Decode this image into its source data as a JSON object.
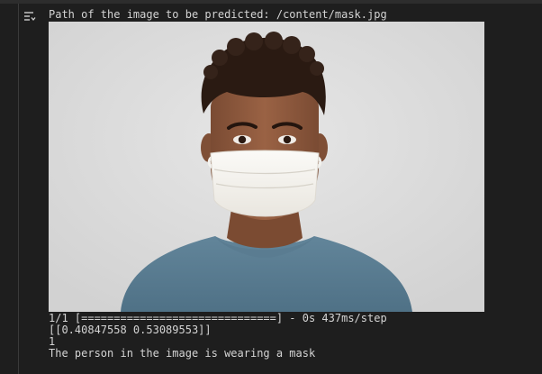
{
  "output": {
    "prompt_text": "Path of the image to be predicted: /content/mask.jpg",
    "image_icon": "person-wearing-mask-photo",
    "progress_line": "1/1 [==============================] - 0s 437ms/step",
    "prediction_array": "[[0.40847558 0.53089553]]",
    "prediction_class": "1",
    "result_text": "The person in the image is wearing a mask"
  },
  "icons": {
    "toggle": "output-toggle-icon"
  },
  "colors": {
    "background": "#1e1e1e",
    "text": "#d4d4d4",
    "image_background": "#dcdcdc"
  }
}
